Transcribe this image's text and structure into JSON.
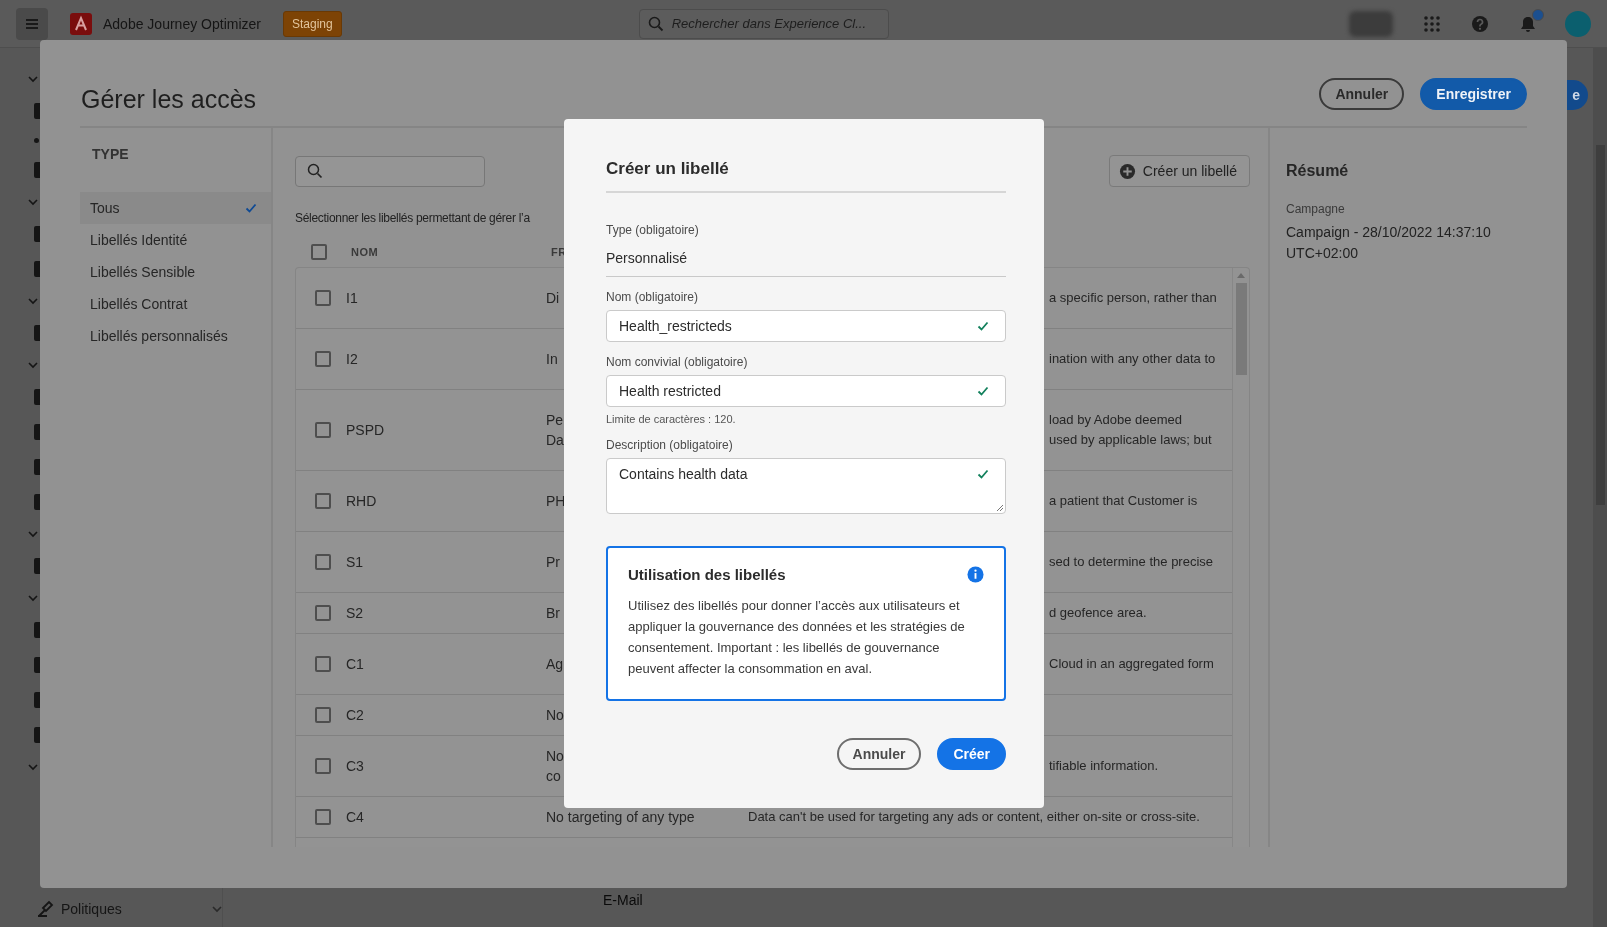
{
  "app": {
    "product": "Adobe Journey Optimizer",
    "environment": "Staging",
    "search_placeholder": "Rechercher dans Experience Cl...",
    "has_notifications": true,
    "nav_item": "Politiques",
    "list_item": "E-Mail",
    "button_fragment": "e"
  },
  "dialog": {
    "title": "Gérer les accès",
    "buttons": [
      {
        "label": "Annuler",
        "kind": "secondary"
      },
      {
        "label": "Enregistrer",
        "kind": "primary"
      }
    ],
    "type_filter": {
      "heading": "TYPE",
      "items": [
        {
          "label": "Tous",
          "selected": true
        },
        {
          "label": "Libellés Identité",
          "selected": false
        },
        {
          "label": "Libellés Sensible",
          "selected": false
        },
        {
          "label": "Libellés Contrat",
          "selected": false
        },
        {
          "label": "Libellés personnalisés",
          "selected": false
        }
      ]
    },
    "create_button": "Créer un libellé",
    "instruction": "Sélectionner les libellés permettant de gérer l’a",
    "table": {
      "header_checked": false,
      "columns": [
        "NOM",
        "FR"
      ],
      "rows": [
        {
          "name": "I1",
          "column_2": "Di",
          "column_3": "a specific person, rather than",
          "kind": "covered",
          "checked": false
        },
        {
          "name": "I2",
          "column_2": "In",
          "column_3": "ination with any other data to",
          "kind": "covered",
          "checked": false
        },
        {
          "name": "PSPD",
          "column_2": "Pe\nDa",
          "column_3": "load by Adobe deemed\nused by applicable laws; but",
          "kind": "covered",
          "checked": false
        },
        {
          "name": "RHD",
          "column_2": "PH",
          "column_3": "a patient that Customer is",
          "kind": "covered",
          "checked": false
        },
        {
          "name": "S1",
          "column_2": "Pr",
          "column_3": "sed to determine the precise",
          "kind": "covered",
          "checked": false
        },
        {
          "name": "S2",
          "column_2": "Br",
          "column_3": "d geofence area.",
          "kind": "covered",
          "checked": false
        },
        {
          "name": "C1",
          "column_2": "Ag",
          "column_3": "Cloud in an aggregated form",
          "kind": "covered",
          "checked": false
        },
        {
          "name": "C2",
          "column_2": "No",
          "kind": "covered",
          "checked": false
        },
        {
          "name": "C3",
          "column_2": "No\nco",
          "column_3": "tifiable information.",
          "kind": "covered",
          "checked": false
        },
        {
          "name": "C4",
          "column_2": "No targeting of any type",
          "column_3": "Data can't be used for targeting any ads or content, either on-site or cross-site.",
          "kind": "full",
          "checked": false
        }
      ]
    },
    "summary": {
      "title": "Résumé",
      "label": "Campagne",
      "value": "Campaign - 28/10/2022 14:37:10 UTC+02:00"
    }
  },
  "modal": {
    "title": "Créer un libellé",
    "fields": [
      {
        "label": "Type (obligatoire)",
        "value": "Personnalisé",
        "kind": "static"
      },
      {
        "label": "Nom (obligatoire)",
        "value": "Health_restricteds",
        "kind": "text",
        "valid": true
      },
      {
        "label": "Nom convivial (obligatoire)",
        "value": "Health restricted",
        "kind": "text",
        "valid": true,
        "help": "Limite de caractères : 120."
      },
      {
        "label": "Description (obligatoire)",
        "value": "Contains health data",
        "kind": "textarea",
        "valid": true
      }
    ],
    "info": {
      "title": "Utilisation des libellés",
      "text": "Utilisez des libellés pour donner l’accès aux utilisateurs et appliquer la gouvernance des données et les stratégies de consentement. Important : les libellés de gouvernance peuvent affecter la consommation en aval."
    },
    "buttons": [
      {
        "label": "Annuler",
        "kind": "secondary"
      },
      {
        "label": "Créer",
        "kind": "primary"
      }
    ]
  }
}
